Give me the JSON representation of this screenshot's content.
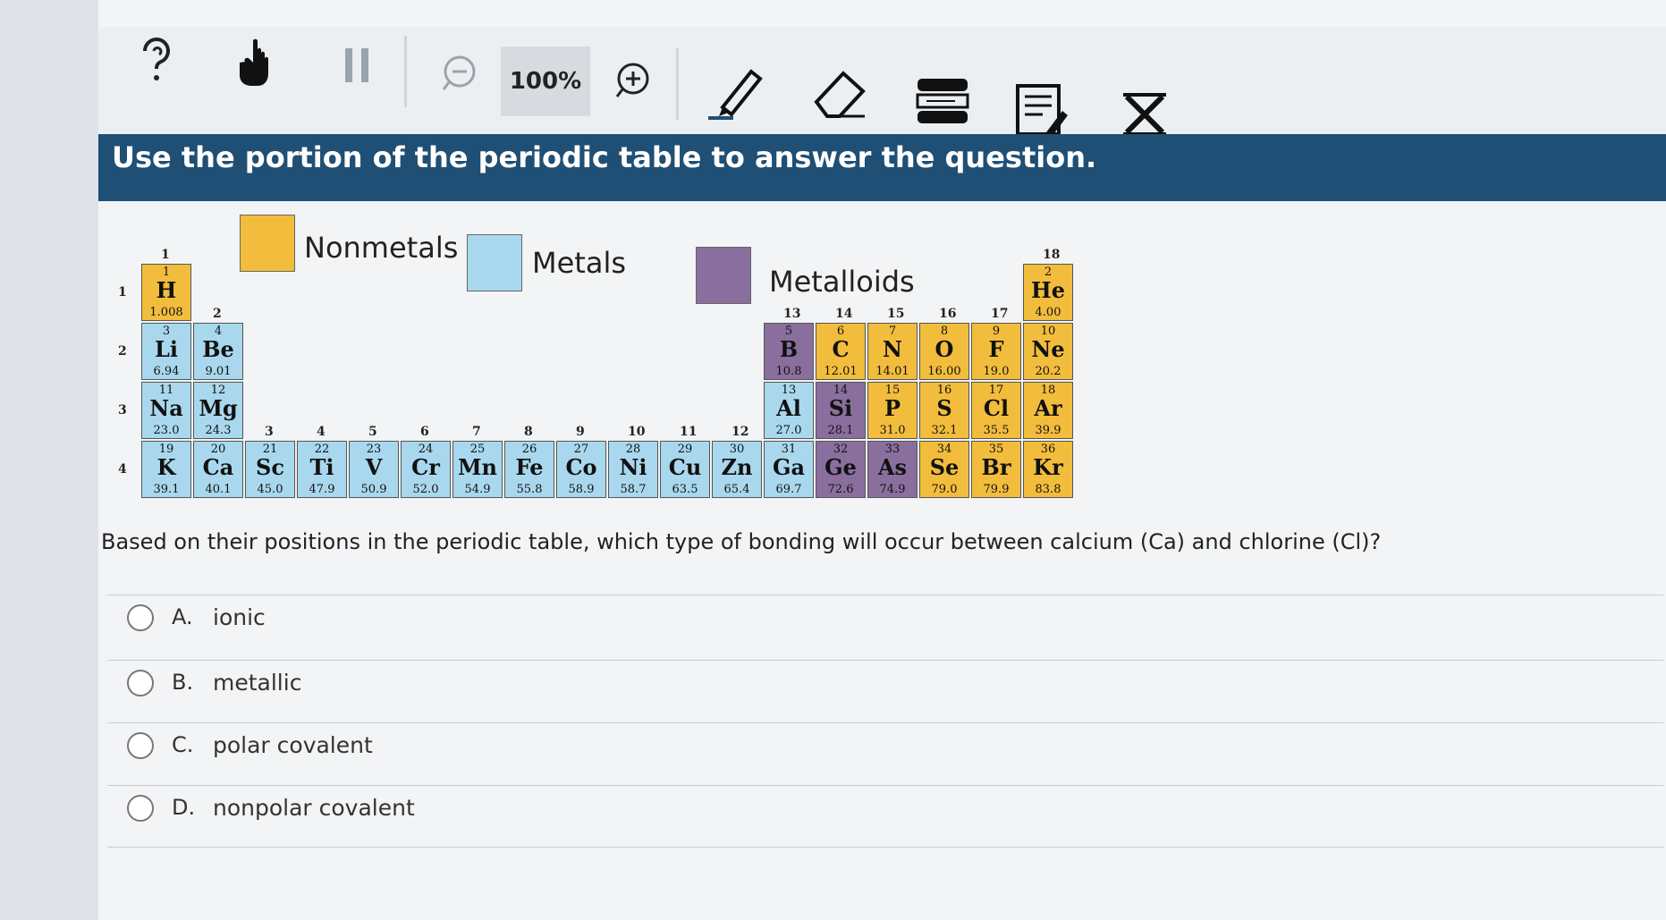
{
  "toolbar": {
    "zoom_value": "100%",
    "icons": [
      "help-icon",
      "pointer-hand-icon",
      "pause-icon",
      "zoom-out-icon",
      "zoom-in-icon",
      "pen-icon",
      "eraser-icon",
      "line-reader-icon",
      "notepad-icon",
      "answer-eliminator-icon"
    ]
  },
  "banner": {
    "text": "Use the portion of the periodic table to answer the question."
  },
  "legend": [
    {
      "label": "Nonmetals",
      "color": "#f2bd3c"
    },
    {
      "label": "Metals",
      "color": "#a9d8ee"
    },
    {
      "label": "Metalloids",
      "color": "#8a6f9e"
    }
  ],
  "periodic_table": {
    "group_labels": [
      "1",
      "2",
      "3",
      "4",
      "5",
      "6",
      "7",
      "8",
      "9",
      "10",
      "11",
      "12",
      "13",
      "14",
      "15",
      "16",
      "17",
      "18"
    ],
    "period_labels": [
      "1",
      "2",
      "3",
      "4"
    ],
    "elements": [
      {
        "num": "1",
        "sym": "H",
        "mass": "1.008",
        "type": "nonmetal",
        "period": 1,
        "group": 1
      },
      {
        "num": "2",
        "sym": "He",
        "mass": "4.00",
        "type": "nonmetal",
        "period": 1,
        "group": 18
      },
      {
        "num": "3",
        "sym": "Li",
        "mass": "6.94",
        "type": "metal",
        "period": 2,
        "group": 1
      },
      {
        "num": "4",
        "sym": "Be",
        "mass": "9.01",
        "type": "metal",
        "period": 2,
        "group": 2
      },
      {
        "num": "5",
        "sym": "B",
        "mass": "10.8",
        "type": "metalloid",
        "period": 2,
        "group": 13
      },
      {
        "num": "6",
        "sym": "C",
        "mass": "12.01",
        "type": "nonmetal",
        "period": 2,
        "group": 14
      },
      {
        "num": "7",
        "sym": "N",
        "mass": "14.01",
        "type": "nonmetal",
        "period": 2,
        "group": 15
      },
      {
        "num": "8",
        "sym": "O",
        "mass": "16.00",
        "type": "nonmetal",
        "period": 2,
        "group": 16
      },
      {
        "num": "9",
        "sym": "F",
        "mass": "19.0",
        "type": "nonmetal",
        "period": 2,
        "group": 17
      },
      {
        "num": "10",
        "sym": "Ne",
        "mass": "20.2",
        "type": "nonmetal",
        "period": 2,
        "group": 18
      },
      {
        "num": "11",
        "sym": "Na",
        "mass": "23.0",
        "type": "metal",
        "period": 3,
        "group": 1
      },
      {
        "num": "12",
        "sym": "Mg",
        "mass": "24.3",
        "type": "metal",
        "period": 3,
        "group": 2
      },
      {
        "num": "13",
        "sym": "Al",
        "mass": "27.0",
        "type": "metal",
        "period": 3,
        "group": 13
      },
      {
        "num": "14",
        "sym": "Si",
        "mass": "28.1",
        "type": "metalloid",
        "period": 3,
        "group": 14
      },
      {
        "num": "15",
        "sym": "P",
        "mass": "31.0",
        "type": "nonmetal",
        "period": 3,
        "group": 15
      },
      {
        "num": "16",
        "sym": "S",
        "mass": "32.1",
        "type": "nonmetal",
        "period": 3,
        "group": 16
      },
      {
        "num": "17",
        "sym": "Cl",
        "mass": "35.5",
        "type": "nonmetal",
        "period": 3,
        "group": 17
      },
      {
        "num": "18",
        "sym": "Ar",
        "mass": "39.9",
        "type": "nonmetal",
        "period": 3,
        "group": 18
      },
      {
        "num": "19",
        "sym": "K",
        "mass": "39.1",
        "type": "metal",
        "period": 4,
        "group": 1
      },
      {
        "num": "20",
        "sym": "Ca",
        "mass": "40.1",
        "type": "metal",
        "period": 4,
        "group": 2
      },
      {
        "num": "21",
        "sym": "Sc",
        "mass": "45.0",
        "type": "metal",
        "period": 4,
        "group": 3
      },
      {
        "num": "22",
        "sym": "Ti",
        "mass": "47.9",
        "type": "metal",
        "period": 4,
        "group": 4
      },
      {
        "num": "23",
        "sym": "V",
        "mass": "50.9",
        "type": "metal",
        "period": 4,
        "group": 5
      },
      {
        "num": "24",
        "sym": "Cr",
        "mass": "52.0",
        "type": "metal",
        "period": 4,
        "group": 6
      },
      {
        "num": "25",
        "sym": "Mn",
        "mass": "54.9",
        "type": "metal",
        "period": 4,
        "group": 7
      },
      {
        "num": "26",
        "sym": "Fe",
        "mass": "55.8",
        "type": "metal",
        "period": 4,
        "group": 8
      },
      {
        "num": "27",
        "sym": "Co",
        "mass": "58.9",
        "type": "metal",
        "period": 4,
        "group": 9
      },
      {
        "num": "28",
        "sym": "Ni",
        "mass": "58.7",
        "type": "metal",
        "period": 4,
        "group": 10
      },
      {
        "num": "29",
        "sym": "Cu",
        "mass": "63.5",
        "type": "metal",
        "period": 4,
        "group": 11
      },
      {
        "num": "30",
        "sym": "Zn",
        "mass": "65.4",
        "type": "metal",
        "period": 4,
        "group": 12
      },
      {
        "num": "31",
        "sym": "Ga",
        "mass": "69.7",
        "type": "metal",
        "period": 4,
        "group": 13
      },
      {
        "num": "32",
        "sym": "Ge",
        "mass": "72.6",
        "type": "metalloid",
        "period": 4,
        "group": 14
      },
      {
        "num": "33",
        "sym": "As",
        "mass": "74.9",
        "type": "metalloid",
        "period": 4,
        "group": 15
      },
      {
        "num": "34",
        "sym": "Se",
        "mass": "79.0",
        "type": "nonmetal",
        "period": 4,
        "group": 16
      },
      {
        "num": "35",
        "sym": "Br",
        "mass": "79.9",
        "type": "nonmetal",
        "period": 4,
        "group": 17
      },
      {
        "num": "36",
        "sym": "Kr",
        "mass": "83.8",
        "type": "nonmetal",
        "period": 4,
        "group": 18
      }
    ]
  },
  "question": {
    "text": "Based on their positions in the periodic table, which type of bonding will occur between calcium (Ca) and chlorine (Cl)?",
    "options": [
      {
        "letter": "A.",
        "text": "ionic"
      },
      {
        "letter": "B.",
        "text": "metallic"
      },
      {
        "letter": "C.",
        "text": "polar covalent"
      },
      {
        "letter": "D.",
        "text": "nonpolar covalent"
      }
    ]
  }
}
